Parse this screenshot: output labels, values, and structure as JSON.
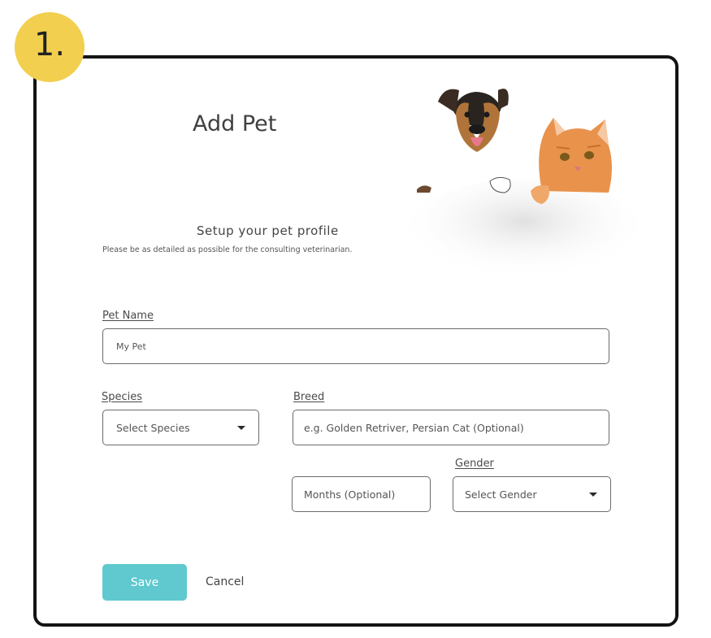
{
  "step": {
    "number": "1."
  },
  "header": {
    "title": "Add Pet"
  },
  "intro": {
    "subtitle": "Setup your pet profile",
    "helper": "Please be as detailed as possible for the consulting veterinarian."
  },
  "form": {
    "pet_name": {
      "label": "Pet Name",
      "placeholder": "My Pet"
    },
    "species": {
      "label": "Species",
      "placeholder": "Select Species"
    },
    "breed": {
      "label": "Breed",
      "placeholder": "e.g. Golden Retriver, Persian Cat (Optional)"
    },
    "age": {
      "placeholder": "Months (Optional)"
    },
    "gender": {
      "label": "Gender",
      "placeholder": "Select Gender"
    }
  },
  "actions": {
    "save_label": "Save",
    "cancel_label": "Cancel"
  },
  "colors": {
    "accent": "#5fc9cf",
    "badge": "#f2cf4f",
    "frame": "#141414"
  }
}
